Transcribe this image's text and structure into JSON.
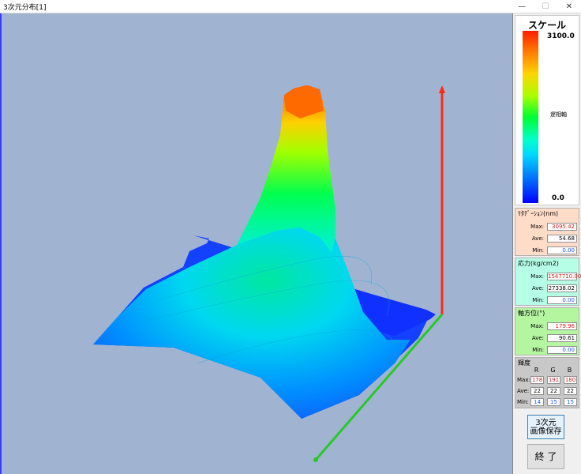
{
  "window": {
    "title": "3次元分布[1]",
    "minimize": "—",
    "maximize": "☐",
    "close": "✕"
  },
  "scale": {
    "title": "スケール",
    "max_label": "3100.0",
    "min_label": "0.0",
    "axis_label": "遅相軸"
  },
  "retardation": {
    "title": "ﾘﾀﾃﾞｰｼｮﾝ(nm)",
    "max_label": "Max:",
    "ave_label": "Ave:",
    "min_label": "Min:",
    "max": "3095.42",
    "ave": "54.68",
    "min": "0.00"
  },
  "stress": {
    "title": "応力(kg/cm2)",
    "max_label": "Max:",
    "ave_label": "Ave:",
    "min_label": "Min:",
    "max": "1547710.00",
    "ave": "27338.02",
    "min": "0.00"
  },
  "azimuth": {
    "title": "軸方位(°)",
    "max_label": "Max:",
    "ave_label": "Ave:",
    "min_label": "Min:",
    "max": "179.96",
    "ave": "90.61",
    "min": "0.00"
  },
  "brightness": {
    "title": "輝度",
    "headers": [
      "R",
      "G",
      "B"
    ],
    "max_label": "Max:",
    "ave_label": "Ave:",
    "min_label": "Min:",
    "max": [
      "178",
      "191",
      "180"
    ],
    "ave": [
      "22",
      "22",
      "22"
    ],
    "min": [
      "14",
      "15",
      "15"
    ]
  },
  "buttons": {
    "save_line1": "3次元",
    "save_line2": "画像保存",
    "exit": "終 了"
  },
  "colors": {
    "viewport_bg": "#a0b4d2",
    "axis_z": "#ff2a14",
    "axis_y": "#28c828",
    "retard_bg": "#ffdcc8",
    "stress_bg": "#b4ffe6",
    "azimuth_bg": "#b4f5a0",
    "brightness_bg": "#c8c8c8"
  }
}
